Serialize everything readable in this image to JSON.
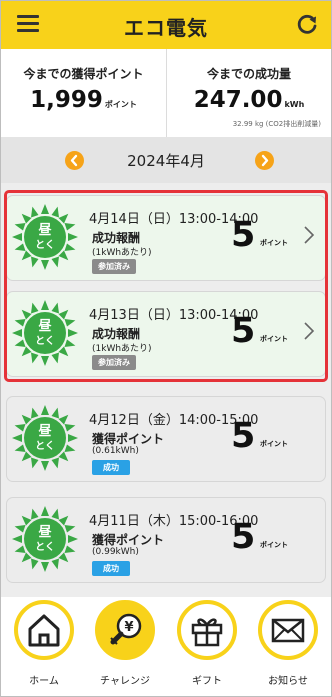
{
  "header": {
    "title": "エコ電気",
    "menu_icon": "hamburger-menu-icon",
    "refresh_icon": "refresh-icon",
    "background": "#f8d21a"
  },
  "summary": {
    "points": {
      "label": "今までの獲得ポイント",
      "value": "1,999",
      "unit": "ポイント"
    },
    "success": {
      "label": "今までの成功量",
      "value": "247.00",
      "unit": "kWh",
      "note": "32.99 kg (CO2排出削減量)"
    }
  },
  "month_nav": {
    "label": "2024年4月",
    "prev_icon": "chevron-left-icon",
    "next_icon": "chevron-right-icon",
    "accent": "#f6a318"
  },
  "cards": [
    {
      "icon": "sun-hirutoku-icon",
      "badge_icon_text": [
        "昼",
        "とく"
      ],
      "date": "4月14日（日）13:00-14:00",
      "kind": "成功報酬",
      "sub": "(1kWhあたり)",
      "status": "参加済み",
      "points": "5",
      "points_unit": "ポイント",
      "selected": true
    },
    {
      "icon": "sun-hirutoku-icon",
      "badge_icon_text": [
        "昼",
        "とく"
      ],
      "date": "4月13日（日）13:00-14:00",
      "kind": "成功報酬",
      "sub": "(1kWhあたり)",
      "status": "参加済み",
      "points": "5",
      "points_unit": "ポイント",
      "selected": true
    },
    {
      "icon": "sun-hirutoku-icon",
      "badge_icon_text": [
        "昼",
        "とく"
      ],
      "date": "4月12日（金）14:00-15:00",
      "kind": "獲得ポイント",
      "sub": "(0.61kWh)",
      "status": "成功",
      "points": "5",
      "points_unit": "ポイント",
      "selected": false
    },
    {
      "icon": "sun-hirutoku-icon",
      "badge_icon_text": [
        "昼",
        "とく"
      ],
      "date": "4月11日（木）15:00-16:00",
      "kind": "獲得ポイント",
      "sub": "(0.99kWh)",
      "status": "成功",
      "points": "5",
      "points_unit": "ポイント",
      "selected": false
    }
  ],
  "bottom_nav": [
    {
      "label": "ホーム",
      "icon": "home-icon",
      "active": false
    },
    {
      "label": "チャレンジ",
      "icon": "lightbulb-yen-icon",
      "active": true
    },
    {
      "label": "ギフト",
      "icon": "gift-icon",
      "active": false
    },
    {
      "label": "お知らせ",
      "icon": "mail-icon",
      "active": false
    }
  ],
  "colors": {
    "sun_green": "#3aa845",
    "selection_red": "#e53238",
    "success_blue": "#2aa1e5",
    "joined_gray": "#8b8b8b"
  }
}
